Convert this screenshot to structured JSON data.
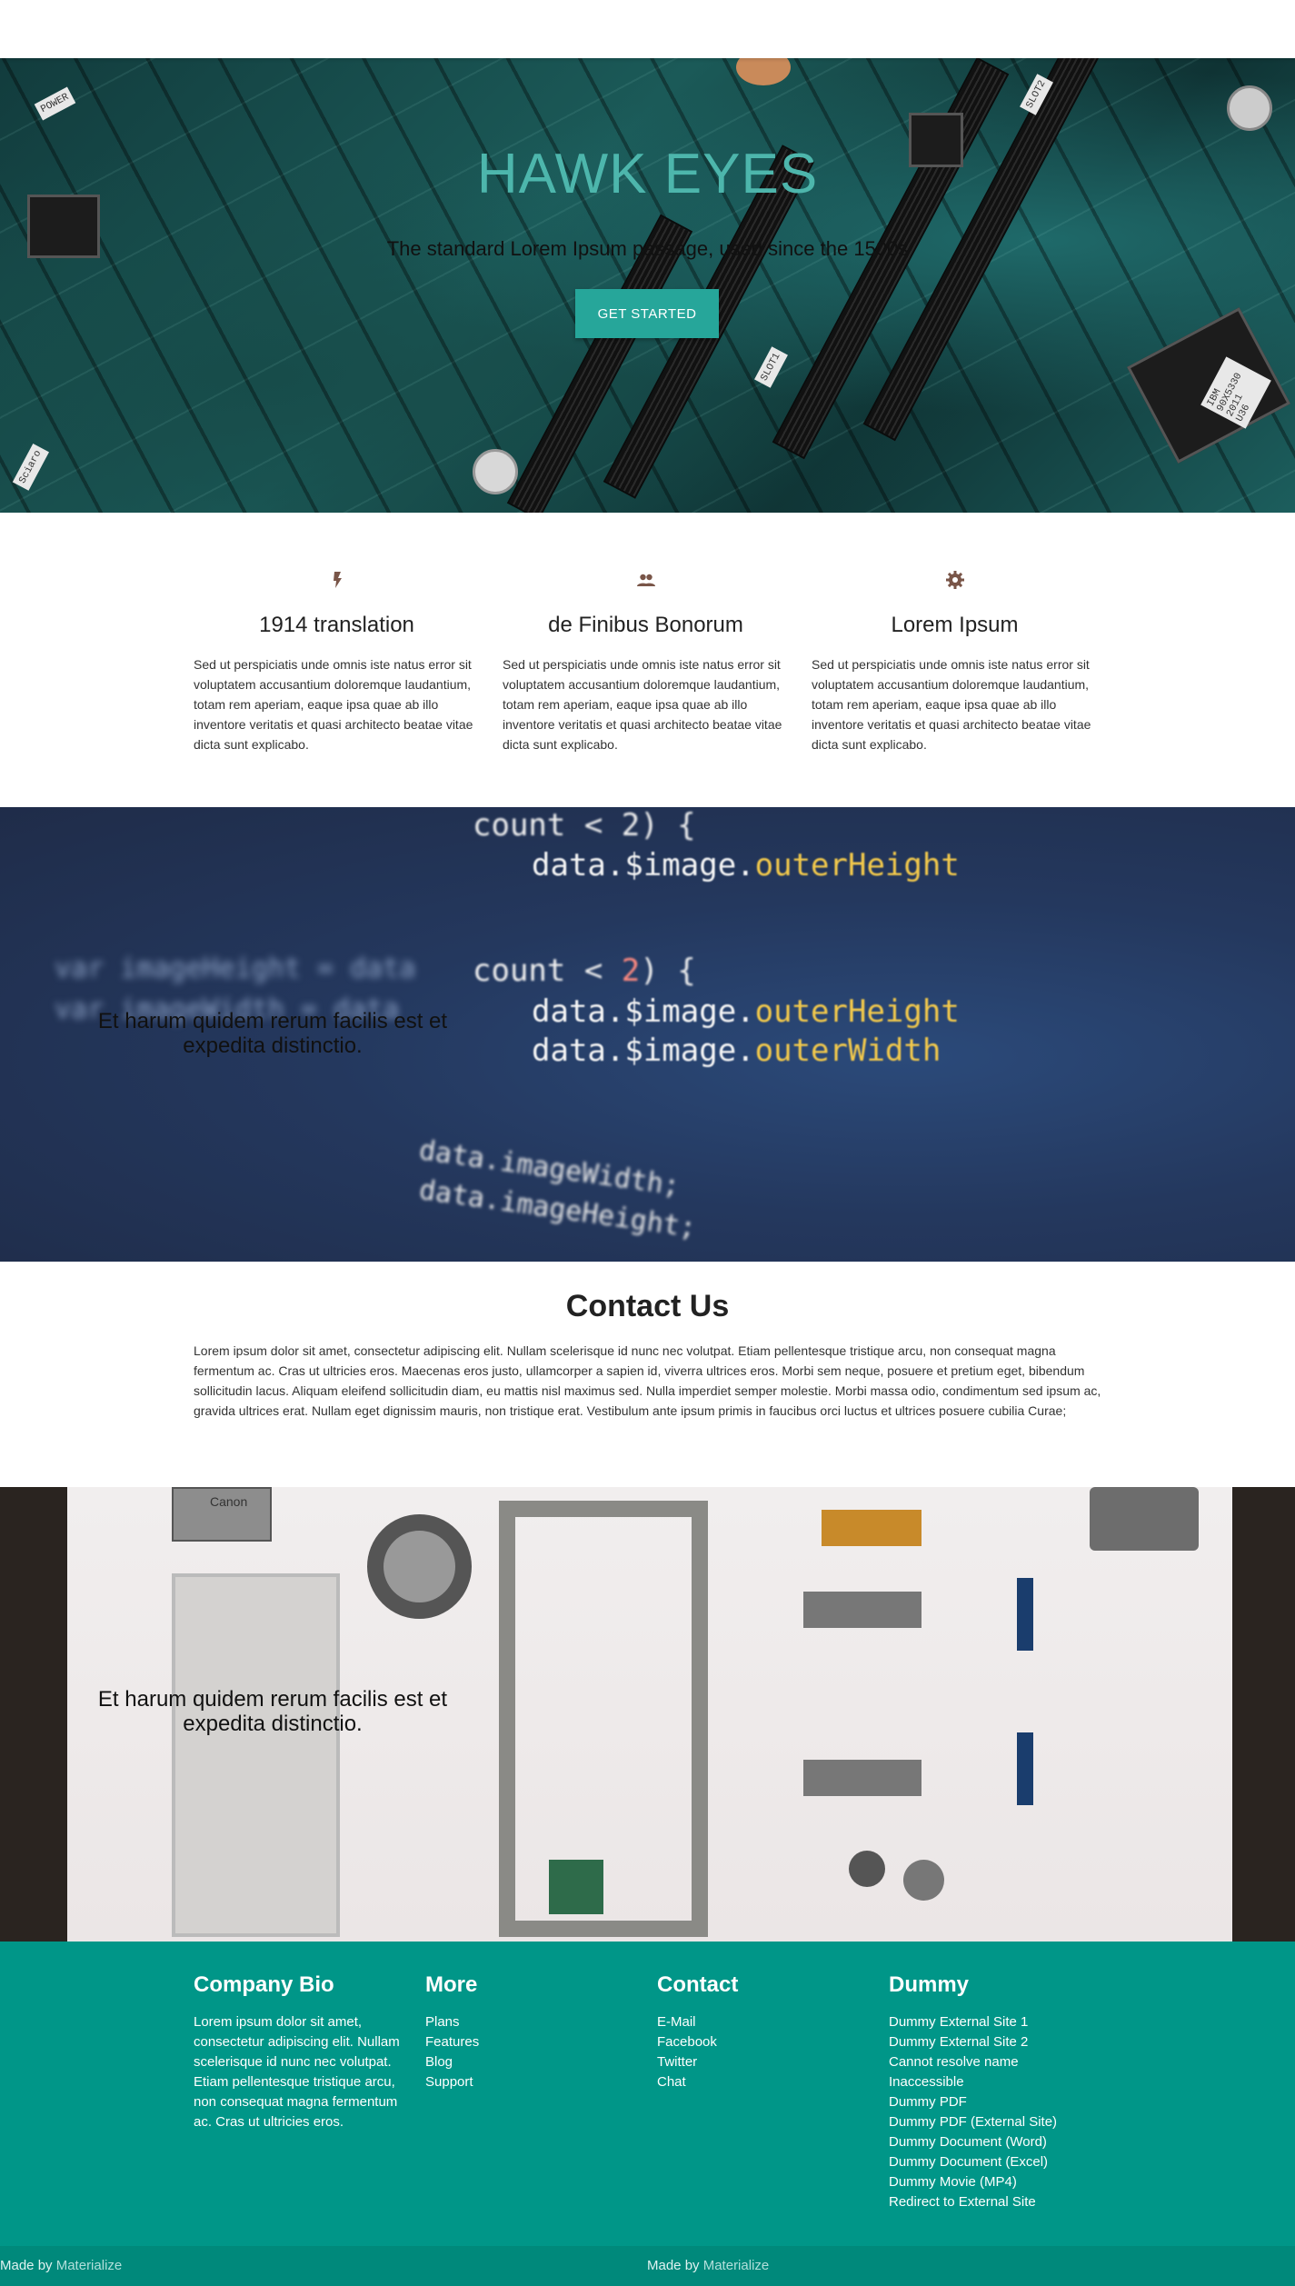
{
  "hero": {
    "title": "HAWK EYES",
    "subtitle": "The standard Lorem Ipsum passage, used since the 1500s",
    "button": "Get Started",
    "board_labels": [
      "POWER",
      "SLOT1",
      "SLOT2",
      "IBM 90X5330 2011 U36",
      "Sciaro"
    ]
  },
  "features": [
    {
      "icon": "flash-icon",
      "title": "1914 translation",
      "text": "Sed ut perspiciatis unde omnis iste natus error sit voluptatem accusantium doloremque laudantium, totam rem aperiam, eaque ipsa quae ab illo inventore veritatis et quasi architecto beatae vitae dicta sunt explicabo."
    },
    {
      "icon": "group-icon",
      "title": "de Finibus Bonorum",
      "text": "Sed ut perspiciatis unde omnis iste natus error sit voluptatem accusantium doloremque laudantium, totam rem aperiam, eaque ipsa quae ab illo inventore veritatis et quasi architecto beatae vitae dicta sunt explicabo."
    },
    {
      "icon": "settings-icon",
      "title": "Lorem Ipsum",
      "text": "Sed ut perspiciatis unde omnis iste natus error sit voluptatem accusantium doloremque laudantium, totam rem aperiam, eaque ipsa quae ab illo inventore veritatis et quasi architecto beatae vitae dicta sunt explicabo."
    }
  ],
  "parallax1": {
    "text": "Et harum quidem rerum facilis est et expedita distinctio.",
    "code_lines": [
      "count < 2) {",
      "data.$image.outerHeight",
      "data.$image.outerWidth",
      "data.imageWidth;",
      "data.imageHeight;"
    ]
  },
  "contact": {
    "title": "Contact Us",
    "text": "Lorem ipsum dolor sit amet, consectetur adipiscing elit. Nullam scelerisque id nunc nec volutpat. Etiam pellentesque tristique arcu, non consequat magna fermentum ac. Cras ut ultricies eros. Maecenas eros justo, ullamcorper a sapien id, viverra ultrices eros. Morbi sem neque, posuere et pretium eget, bibendum sollicitudin lacus. Aliquam eleifend sollicitudin diam, eu mattis nisl maximus sed. Nulla imperdiet semper molestie. Morbi massa odio, condimentum sed ipsum ac, gravida ultrices erat. Nullam eget dignissim mauris, non tristique erat. Vestibulum ante ipsum primis in faucibus orci luctus et ultrices posuere cubilia Curae;"
  },
  "parallax2": {
    "text": "Et harum quidem rerum facilis est et expedita distinctio.",
    "camera_brand": "Canon"
  },
  "footer": {
    "bio": {
      "title": "Company Bio",
      "text": "Lorem ipsum dolor sit amet, consectetur adipiscing elit. Nullam scelerisque id nunc nec volutpat. Etiam pellentesque tristique arcu, non consequat magna fermentum ac. Cras ut ultricies eros."
    },
    "more": {
      "title": "More",
      "links": [
        "Plans",
        "Features",
        "Blog",
        "Support"
      ]
    },
    "contact": {
      "title": "Contact",
      "links": [
        "E-Mail",
        "Facebook",
        "Twitter",
        "Chat"
      ]
    },
    "dummy": {
      "title": "Dummy",
      "links": [
        "Dummy External Site 1",
        "Dummy External Site 2",
        "Cannot resolve name",
        "Inaccessible",
        "Dummy PDF",
        "Dummy PDF (External Site)",
        "Dummy Document (Word)",
        "Dummy Document (Excel)",
        "Dummy Movie (MP4)",
        "Redirect to External Site"
      ]
    },
    "made_by": "Made by",
    "made_by_link": "Materialize"
  },
  "colors": {
    "accent": "#26a69a",
    "footer": "#009688",
    "footer_bar": "#00897b",
    "icon": "#795548",
    "hero_title": "#4db6ac"
  }
}
